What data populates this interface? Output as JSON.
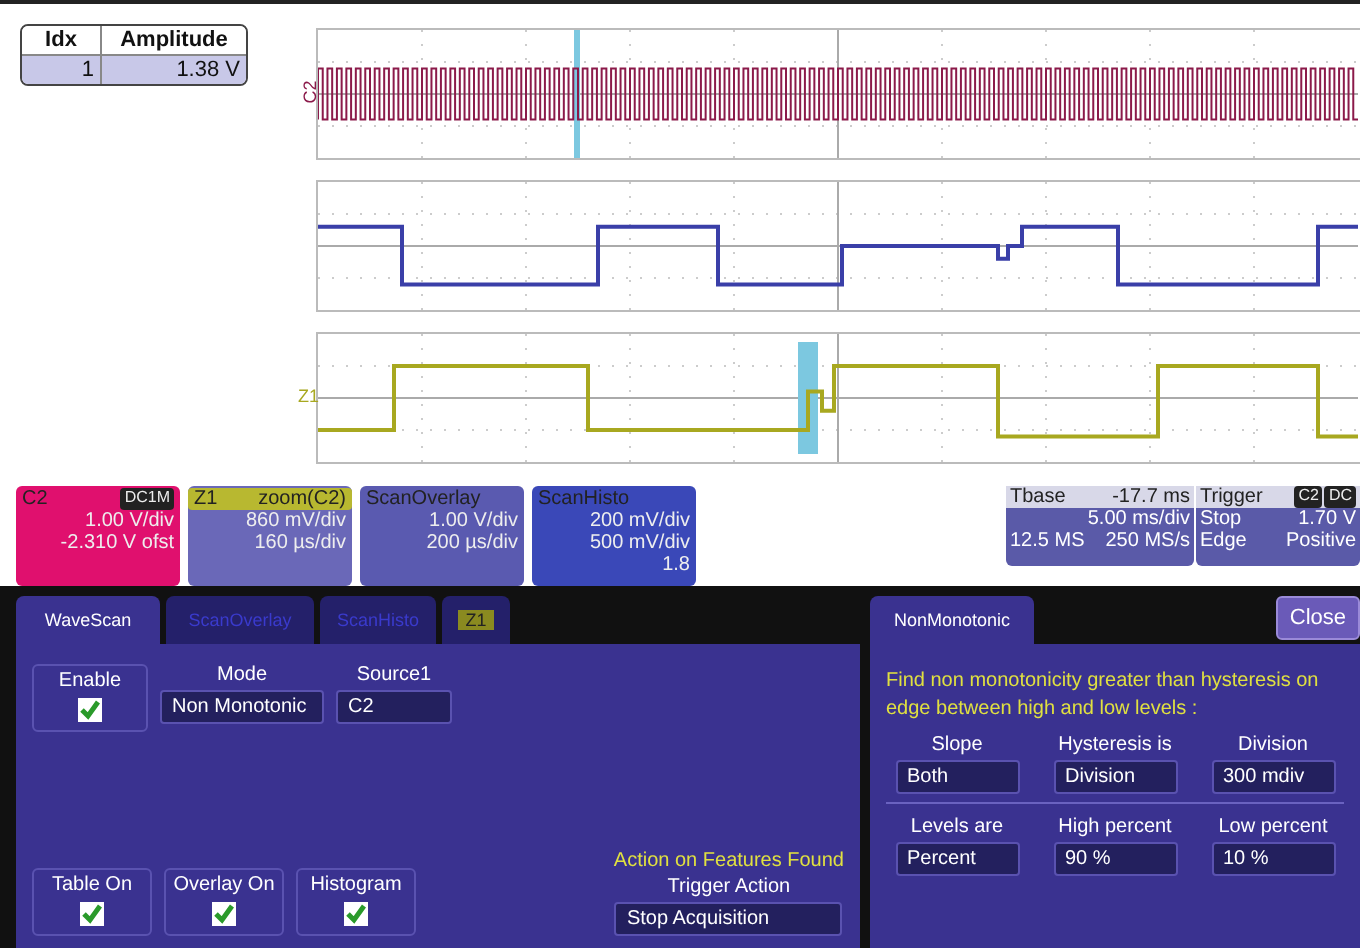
{
  "table": {
    "columns": [
      "Idx",
      "Amplitude"
    ],
    "rows": [
      [
        "1",
        "1.38 V"
      ]
    ]
  },
  "traces": [
    {
      "label": "C2",
      "kind": "pulses",
      "color": "#8b1a4a"
    },
    {
      "kind": "square",
      "color": "#3a3fa8"
    },
    {
      "label": "Z1",
      "kind": "zoom",
      "color": "#a8a820"
    }
  ],
  "descriptors": [
    {
      "title": "C2",
      "badge": "DC1M",
      "lines": [
        "1.00 V/div",
        "-2.310 V ofst"
      ],
      "color": "#e0106e"
    },
    {
      "title": "Z1",
      "subtitle": "zoom(C2)",
      "lines": [
        "860 mV/div",
        "160 µs/div"
      ],
      "color": "#6a68b8"
    },
    {
      "title": "ScanOverlay",
      "lines": [
        "1.00 V/div",
        "200 µs/div"
      ],
      "color": "#5a5ab0"
    },
    {
      "title": "ScanHisto",
      "lines": [
        "200 mV/div",
        "500 mV/div",
        "1.8"
      ],
      "color": "#3a48b8"
    }
  ],
  "timebase": {
    "title": "Tbase",
    "offset": "-17.7 ms",
    "scale": "5.00 ms/div",
    "samples": "12.5 MS",
    "rate": "250 MS/s"
  },
  "trigger": {
    "title": "Trigger",
    "source": "C2",
    "coupling": "DC",
    "mode": "Stop",
    "level": "1.70 V",
    "type": "Edge",
    "slope": "Positive"
  },
  "wavescan": {
    "tabs": [
      {
        "label": "WaveScan",
        "selected": true
      },
      {
        "label": "ScanOverlay",
        "selected": false
      },
      {
        "label": "ScanHisto",
        "selected": false
      },
      {
        "label": "Z1",
        "selected": false
      }
    ],
    "enable": {
      "label": "Enable",
      "checked": true
    },
    "mode": {
      "label": "Mode",
      "value": "Non Monotonic"
    },
    "source": {
      "label": "Source1",
      "value": "C2"
    },
    "toggles": [
      {
        "label": "Table On",
        "checked": true
      },
      {
        "label": "Overlay On",
        "checked": true
      },
      {
        "label": "Histogram",
        "checked": true
      }
    ],
    "action": {
      "heading": "Action on Features Found",
      "label": "Trigger Action",
      "value": "Stop Acquisition"
    }
  },
  "nonmonotonic": {
    "tab": "NonMonotonic",
    "close": "Close",
    "description": "Find non monotonicity greater than hysteresis on edge between high and low levels :",
    "rows": [
      [
        {
          "label": "Slope",
          "value": "Both"
        },
        {
          "label": "Hysteresis is",
          "value": "Division"
        },
        {
          "label": "Division",
          "value": "300 mdiv"
        }
      ],
      [
        {
          "label": "Levels are",
          "value": "Percent"
        },
        {
          "label": "High percent",
          "value": "90 %"
        },
        {
          "label": "Low percent",
          "value": "10 %"
        }
      ]
    ]
  }
}
